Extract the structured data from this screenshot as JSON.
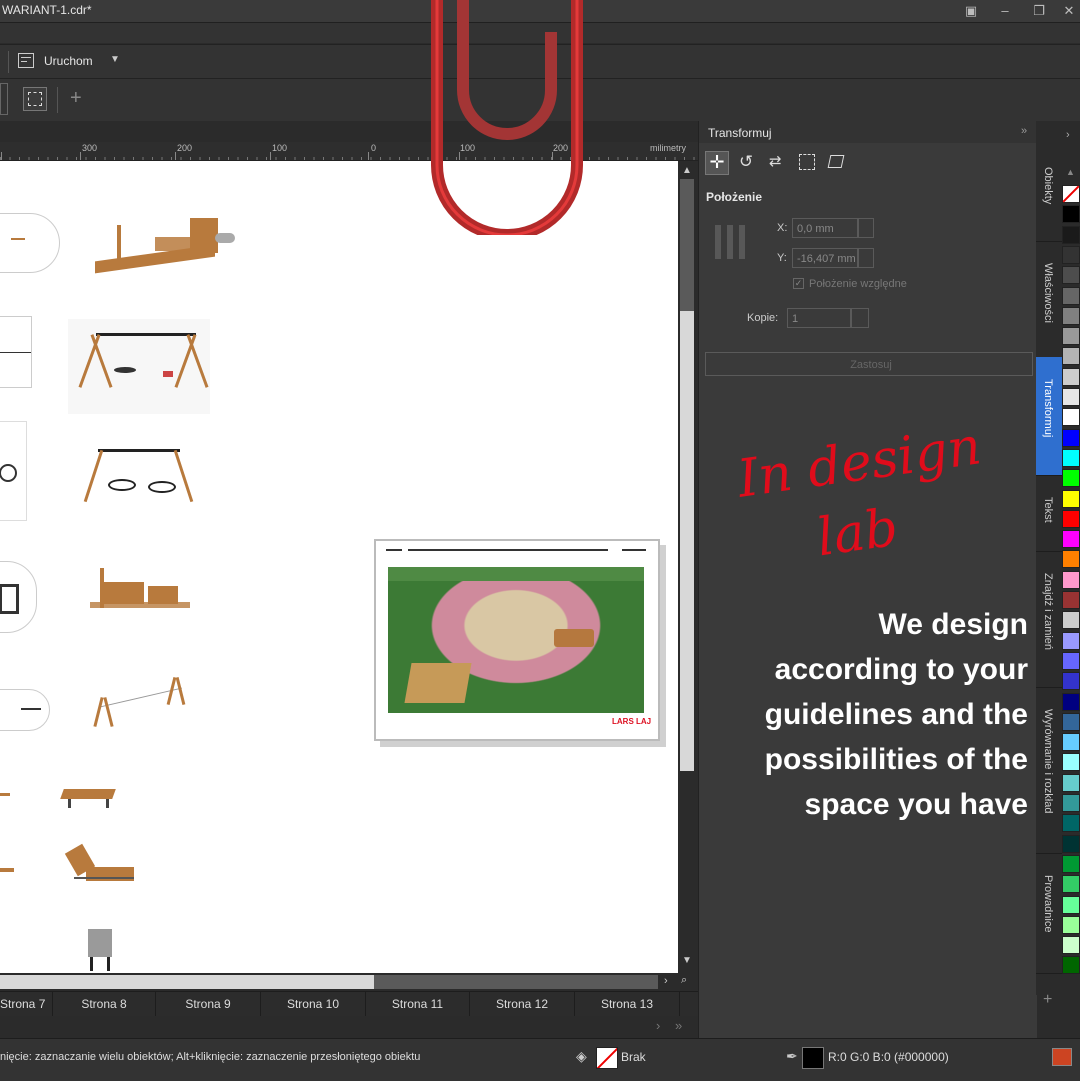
{
  "window": {
    "title": "WARIANT-1.cdr*"
  },
  "toolbar": {
    "run_label": "Uruchom"
  },
  "ruler": {
    "unit": "milimetry",
    "labels": [
      "300",
      "200",
      "100",
      "0",
      "100",
      "200"
    ]
  },
  "docker": {
    "title": "Transformuj",
    "section": "Położenie",
    "x_label": "X:",
    "x_value": "0,0 mm",
    "y_label": "Y:",
    "y_value": "-16,407 mm",
    "relative_label": "Położenie względne",
    "copies_label": "Kopie:",
    "copies_value": "1",
    "apply_label": "Zastosuj"
  },
  "side_tabs": [
    "Obiekty",
    "Właściwości",
    "Transformuj",
    "Tekst",
    "Znajdź i zamień",
    "Wyrównanie i rozkład",
    "Prowadnice"
  ],
  "pages": [
    "Strona 7",
    "Strona 8",
    "Strona 9",
    "Strona 10",
    "Strona 11",
    "Strona 12",
    "Strona 13"
  ],
  "status": {
    "hint": "nięcie: zaznaczanie wielu obiektów; Alt+kliknięcie: zaznaczenie przesłoniętego obiektu",
    "fill_label": "Brak",
    "outline_label": "R:0 G:0 B:0 (#000000)"
  },
  "promo": {
    "script_line1": "In design",
    "script_line2": "lab",
    "lines": [
      "We design",
      "according to your",
      "guidelines and the",
      "possibilities of the",
      "space you have"
    ]
  },
  "brand": {
    "logo": "LARS LAJ"
  },
  "colors": {
    "accent": "#e00c1b",
    "clip": "#b22a2a"
  },
  "palette": [
    "#ffffff",
    "#000000",
    "#1a1a1a",
    "#333333",
    "#4d4d4d",
    "#666666",
    "#808080",
    "#999999",
    "#b3b3b3",
    "#cccccc",
    "#e6e6e6",
    "#ffffff",
    "#0000ff",
    "#00ffff",
    "#00ff00",
    "#ffff00",
    "#ff0000",
    "#ff00ff",
    "#ff8000",
    "#ff99cc",
    "#993333",
    "#cccccc",
    "#9999ff",
    "#6666ff",
    "#3333cc",
    "#000080",
    "#336699",
    "#66ccff",
    "#99ffff",
    "#66cccc",
    "#339999",
    "#006666",
    "#003333",
    "#009933",
    "#33cc66",
    "#66ff99",
    "#99ff99",
    "#ccffcc",
    "#006600"
  ]
}
